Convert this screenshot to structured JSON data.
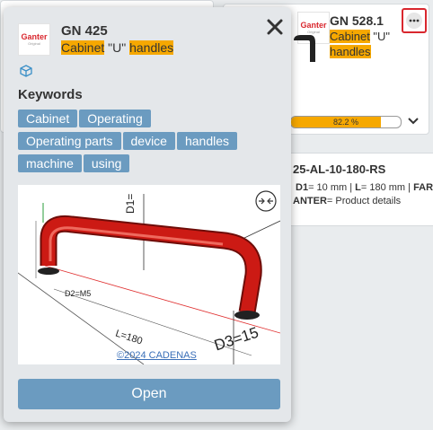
{
  "popup": {
    "logo": {
      "mark": "Ganter",
      "sub": "Original"
    },
    "code": "GN 425",
    "title": {
      "w1": "Cabinet",
      "w2": " \"U\" ",
      "w3": "handles"
    },
    "keywords_heading": "Keywords",
    "keywords": [
      "Cabinet",
      "Operating",
      "Operating parts",
      "device",
      "handles",
      "machine",
      "using"
    ],
    "image": {
      "copyright": "©2024 CADENAS",
      "dims": {
        "d1": "D1=",
        "l": "L=180",
        "d2": "D2=M5",
        "d3": "D3=15"
      }
    },
    "open_label": "Open"
  },
  "card_right": {
    "code": "GN 528.1",
    "title": {
      "w1": "Cabinet",
      "w2": " \"U\"",
      "w3": "handles"
    },
    "progress_text": "82.2 %",
    "progress_value": 82.2
  },
  "row_right": {
    "code": "25-AL-10-180-RS",
    "spec_b1": "D1",
    "spec_t1": "= 10 mm | ",
    "spec_b2": "L",
    "spec_t2": "= 180 mm | ",
    "spec_b3": "FAR",
    "line2_b": "ANTER",
    "line2_t": "= Product details"
  },
  "colors": {
    "accent": "#6b9bc0",
    "highlight": "#f6a800",
    "tube": "#cc1a14",
    "close_border": "#d9272e"
  }
}
